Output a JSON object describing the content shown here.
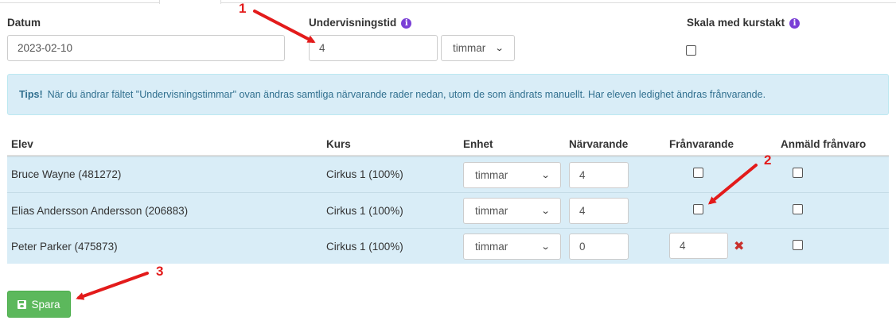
{
  "form": {
    "date_label": "Datum",
    "date_value": "2023-02-10",
    "teaching_time_label": "Undervisningstid",
    "teaching_time_value": "4",
    "unit_value": "timmar",
    "scale_label": "Skala med kurstakt",
    "info_glyph": "i"
  },
  "alert": {
    "title": "Tips!",
    "text": "När du ändrar fältet \"Undervisningstimmar\" ovan ändras samtliga närvarande rader nedan, utom de som ändrats manuellt. Har eleven ledighet ändras frånvarande."
  },
  "table": {
    "headers": [
      "Elev",
      "Kurs",
      "Enhet",
      "Närvarande",
      "Frånvarande",
      "Anmäld frånvaro"
    ],
    "rows": [
      {
        "student": "Bruce Wayne (481272)",
        "course": "Cirkus 1 (100%)",
        "unit": "timmar",
        "present": "4",
        "absent": "",
        "reported": ""
      },
      {
        "student": "Elias Andersson Andersson (206883)",
        "course": "Cirkus 1 (100%)",
        "unit": "timmar",
        "present": "4",
        "absent": "",
        "reported": ""
      },
      {
        "student": "Peter Parker (475873)",
        "course": "Cirkus 1 (100%)",
        "unit": "timmar",
        "present": "0",
        "absent": "4",
        "reported": ""
      }
    ]
  },
  "save_label": "Spara",
  "annotations": [
    "1",
    "2",
    "3"
  ],
  "icons": {
    "info": "info-icon",
    "save": "floppy-disk-icon",
    "remove": "close-icon",
    "select": "chevron-down-icon"
  },
  "colors": {
    "alert_bg": "#d9edf7",
    "alert_text": "#31708f",
    "save_bg": "#5cb85c",
    "annotation": "#e31b1b",
    "info_icon": "#7a3fd6"
  }
}
